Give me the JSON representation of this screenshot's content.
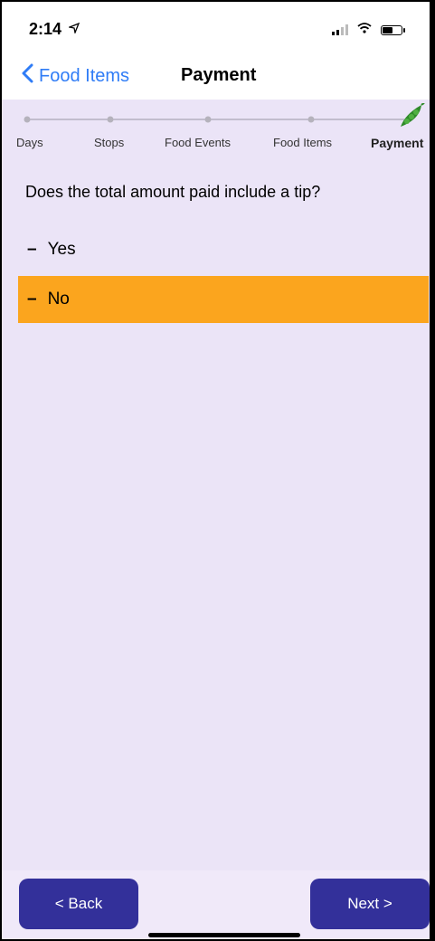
{
  "status_bar": {
    "time": "2:14"
  },
  "nav": {
    "back_label": "Food Items",
    "title": "Payment"
  },
  "progress": {
    "steps": [
      "Days",
      "Stops",
      "Food Events",
      "Food Items",
      "Payment"
    ],
    "current_step": "Payment"
  },
  "question": "Does the total amount paid include a tip?",
  "options": [
    {
      "dash": "–",
      "label": "Yes",
      "selected": false
    },
    {
      "dash": "–",
      "label": "No",
      "selected": true
    }
  ],
  "selection_color": "#fba51e",
  "footer": {
    "back_label": "< Back",
    "next_label": "Next >"
  }
}
